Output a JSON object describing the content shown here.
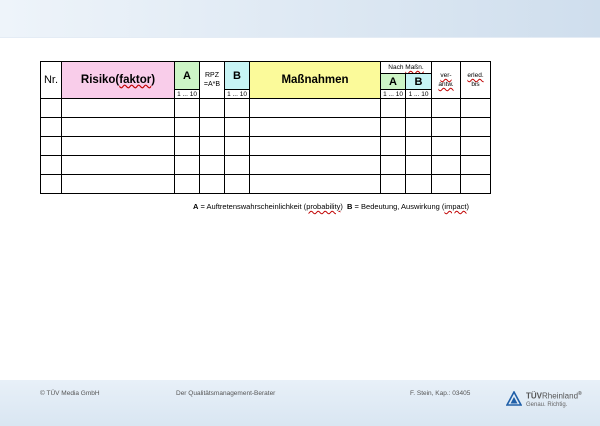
{
  "table": {
    "headers": {
      "nr": "Nr.",
      "risiko_prefix": "Risiko(",
      "risiko_word": "faktor",
      "risiko_suffix": ")",
      "a": "A",
      "rpz_line1": "RPZ",
      "rpz_line2": "=A*B",
      "b": "B",
      "massnahmen": "Maßnahmen",
      "nach_prefix": "Nach ",
      "nach_word": "Maßn.",
      "nach_a": "A",
      "nach_b": "B",
      "verantw_line1": "ver-",
      "verantw_line2": "antw.",
      "erled_line1": "erled.",
      "erled_line2": "bis"
    },
    "scales": {
      "a": "1 ... 10",
      "b": "1 ... 10",
      "nach_a": "1 ... 10",
      "nach_b": "1 ... 10"
    },
    "empty_rows": 5
  },
  "legend": {
    "a_key": "A",
    "a_text": " = Auftretenswahrscheinlichkeit (",
    "a_term": "probability",
    "a_close": ")",
    "b_key": "B",
    "b_text": " = Bedeutung, Auswirkung (",
    "b_term": "impact",
    "b_close": ")"
  },
  "footer": {
    "copyright": "© TÜV Media GmbH",
    "title": "Der Qualitätsmanagement-Berater",
    "reference": "F. Stein, Kap.: 03405"
  },
  "logo": {
    "brand_bold": "TÜV",
    "brand_rest": "Rheinland",
    "registered": "®",
    "tagline": "Genau. Richtig."
  },
  "colors": {
    "risiko": "#f9cdea",
    "a_column": "#cdf5c6",
    "b_column": "#c7f4f5",
    "massnahmen": "#fbfa9a"
  }
}
